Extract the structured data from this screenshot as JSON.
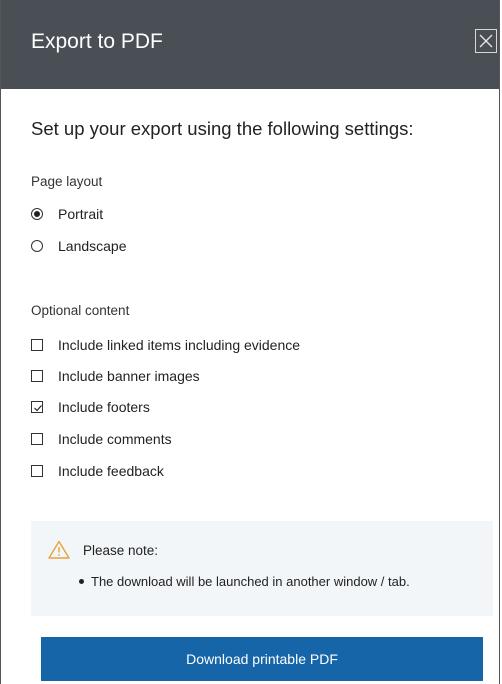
{
  "dialog": {
    "title": "Export to PDF",
    "close_icon": "close-icon"
  },
  "intro": "Set up your export using the following settings:",
  "page_layout": {
    "label": "Page layout",
    "options": [
      {
        "label": "Portrait",
        "selected": true
      },
      {
        "label": "Landscape",
        "selected": false
      }
    ]
  },
  "optional_content": {
    "label": "Optional content",
    "options": [
      {
        "label": "Include linked items including evidence",
        "checked": false
      },
      {
        "label": "Include banner images",
        "checked": false
      },
      {
        "label": "Include footers",
        "checked": true
      },
      {
        "label": "Include comments",
        "checked": false
      },
      {
        "label": "Include feedback",
        "checked": false
      }
    ]
  },
  "note": {
    "icon": "warning-icon",
    "title": "Please note:",
    "bullet": "The download will be launched in another window / tab."
  },
  "download_button": "Download printable PDF",
  "colors": {
    "header_bg": "#4a4e55",
    "button_bg": "#1565a8",
    "warning": "#e8a23a",
    "note_bg": "#f3f6f9"
  }
}
